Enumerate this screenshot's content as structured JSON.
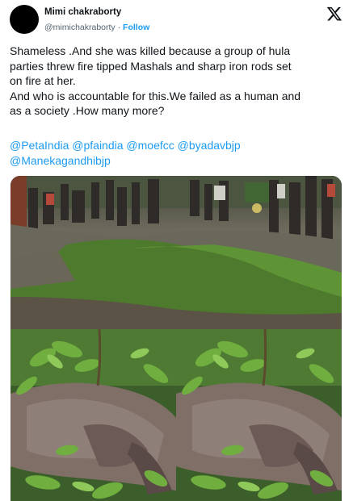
{
  "author": {
    "display_name": "Mimi chakraborty",
    "handle": "@mimichakraborty",
    "separator": "·",
    "follow_label": "Follow"
  },
  "tweet": {
    "lines_para1": [
      "Shameless .And she was killed because a group of hula",
      "parties threw fire tipped Mashals and sharp iron rods set",
      "on fire at her."
    ],
    "lines_para2": [
      "And who is accountable for this.We failed as a human  and",
      "as a society .How many more?"
    ],
    "mentions_line1": [
      "@PetaIndia",
      "@pfaindia",
      "@moefcc",
      "@byadavbjp"
    ],
    "mentions_line2": [
      "@Manekagandhibjp"
    ]
  },
  "icons": {
    "platform_logo": "x-logo-icon"
  },
  "colors": {
    "link": "#1d9bf0",
    "text": "#0f1419",
    "muted": "#536471"
  }
}
